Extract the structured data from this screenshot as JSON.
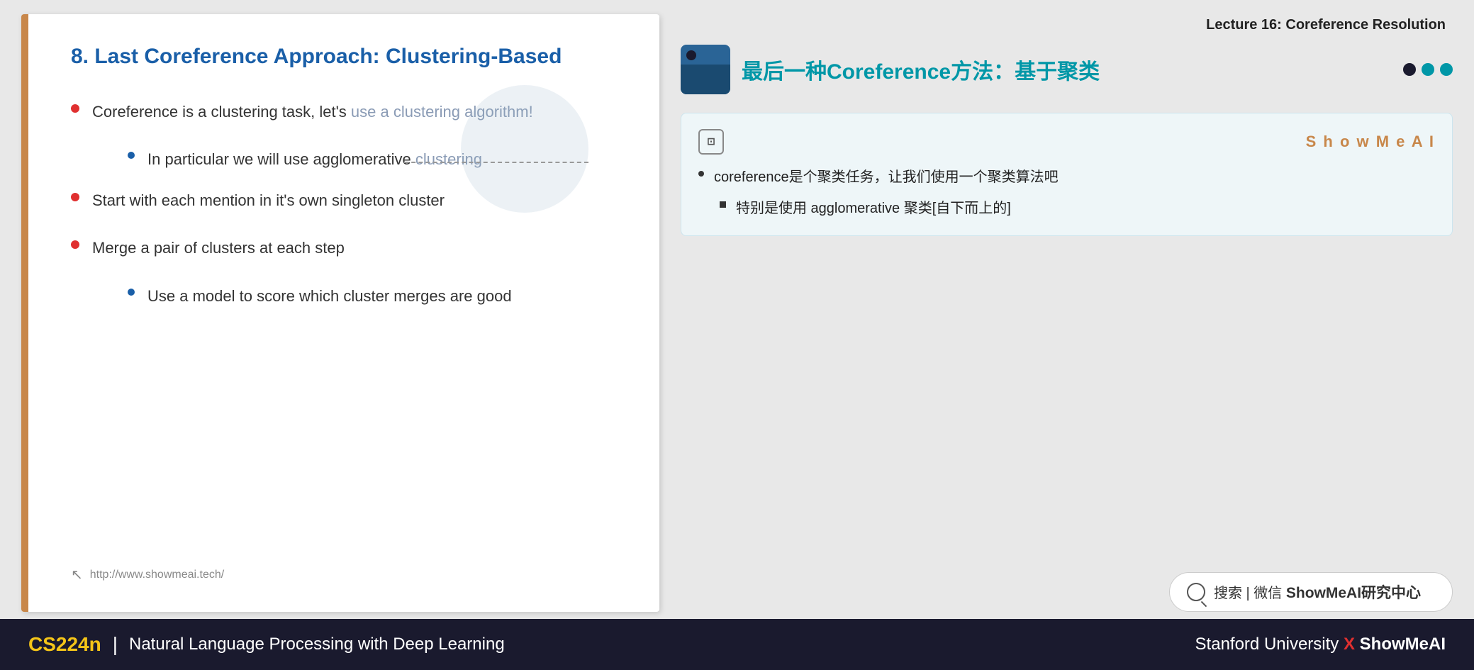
{
  "lecture": {
    "title": "Lecture 16: Coreference Resolution"
  },
  "slide": {
    "number": "8",
    "title": "8. Last Coreference Approach: Clustering-Based",
    "bullets": [
      {
        "text": "Coreference is a clustering task, let's use a clustering algorithm!",
        "highlight_part": "use a clustering algorithm!",
        "sub_bullets": [
          "In particular we will use agglomerative clustering"
        ]
      },
      {
        "text": "Start with each mention in it's own singleton cluster",
        "sub_bullets": []
      },
      {
        "text": "Merge a pair of clusters at each step",
        "sub_bullets": [
          "Use a model to score which cluster merges are good"
        ]
      }
    ],
    "footer_url": "http://www.showmeai.tech/"
  },
  "translation_panel": {
    "title_zh": "最后一种Coreference方法：基于聚类",
    "showmeai_label": "S h o w M e A I",
    "card": {
      "bullet1": "coreference是个聚类任务，让我们使用一个聚类算法吧",
      "sub1": "特别是使用 agglomerative 聚类[自下而上的]"
    }
  },
  "search_box": {
    "text": "搜索 | 微信 ShowMeAI研究中心"
  },
  "footer": {
    "course_code": "CS224n",
    "separator": "|",
    "course_name": "Natural Language Processing with Deep Learning",
    "university": "Stanford University",
    "x_mark": "X",
    "brand": "ShowMeAI"
  }
}
